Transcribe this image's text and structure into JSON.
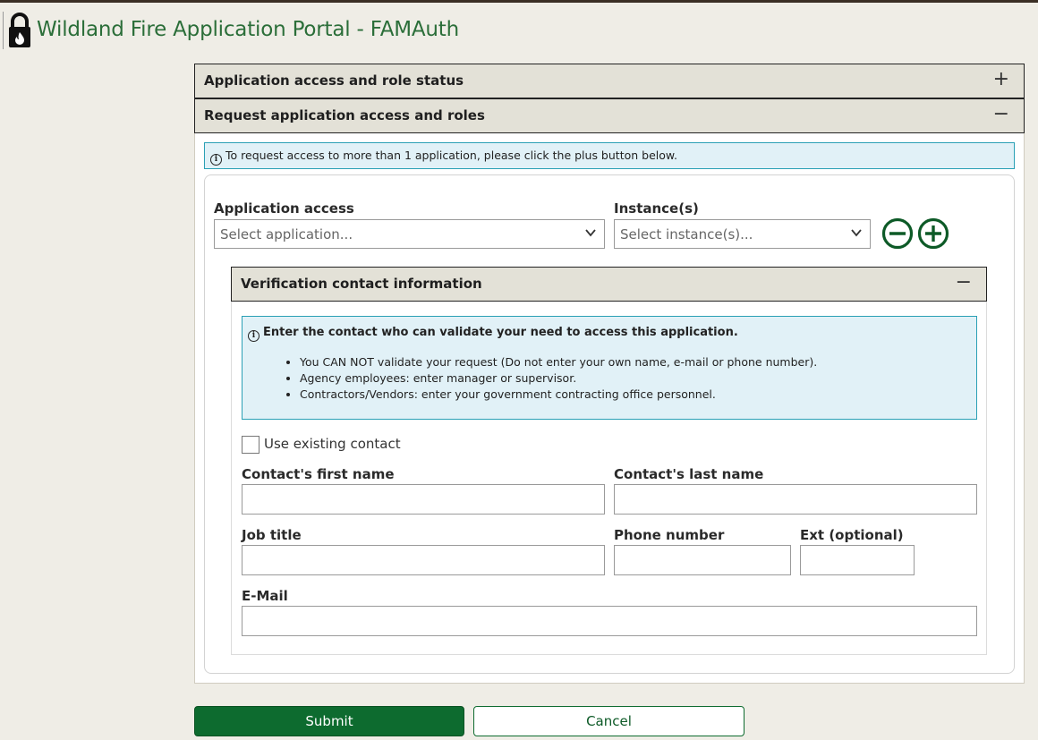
{
  "header": {
    "title": "Wildland Fire Application Portal - FAMAuth",
    "logo_icon": "lock-flame-icon"
  },
  "accordions": [
    {
      "label": "Application access and role status",
      "toggle": "+"
    },
    {
      "label": "Request application access and roles",
      "toggle": "−"
    }
  ],
  "notice": {
    "text": "To request access to more than 1 application, please click the plus button below."
  },
  "request": {
    "app_label": "Application access",
    "app_placeholder": "Select application...",
    "instance_label": "Instance(s)",
    "instance_placeholder": "Select instance(s)...",
    "remove_icon": "minus-circle-icon",
    "add_icon": "plus-circle-icon"
  },
  "verification": {
    "title": "Verification contact information",
    "toggle": "−",
    "info_heading": "Enter the contact who can validate your need to access this application.",
    "bullets": [
      "You CAN NOT validate your request (Do not enter your own name, e-mail or phone number).",
      "Agency employees: enter manager or supervisor.",
      "Contractors/Vendors: enter your government contracting office personnel."
    ],
    "use_existing": "Use existing contact",
    "first_name": "Contact's first name",
    "last_name": "Contact's last name",
    "job_title": "Job title",
    "phone": "Phone number",
    "ext": "Ext (optional)",
    "email": "E-Mail"
  },
  "actions": {
    "submit": "Submit",
    "cancel": "Cancel"
  },
  "colors": {
    "brand_green": "#0d6b2f",
    "title_green": "#2b6e39",
    "info_bg": "#e1f1f7",
    "info_border": "#2aa0b5"
  }
}
